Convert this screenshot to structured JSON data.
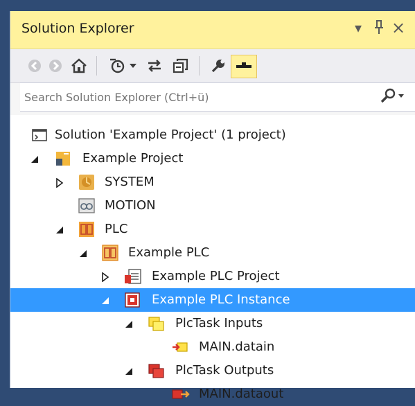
{
  "panel": {
    "title": "Solution Explorer",
    "pin_glyph": "▾",
    "dock_glyph": "⊥",
    "close_glyph": "×"
  },
  "toolbar": {
    "icons": [
      "back-icon",
      "forward-icon",
      "home-icon",
      "pending-changes-icon",
      "dropdown-icon",
      "sync-icon",
      "collapse-all-icon",
      "properties-icon",
      "preview-icon"
    ]
  },
  "search": {
    "placeholder": "Search Solution Explorer (Ctrl+ü)"
  },
  "tree": {
    "solution": "Solution 'Example Project' (1 project)",
    "project": "Example Project",
    "system": "SYSTEM",
    "motion": "MOTION",
    "plc": "PLC",
    "example_plc": "Example PLC",
    "plc_project": "Example PLC Project",
    "plc_instance": "Example PLC Instance",
    "task_inputs": "PlcTask Inputs",
    "main_datain": "MAIN.datain",
    "task_outputs": "PlcTask Outputs",
    "main_dataout": "MAIN.dataout"
  },
  "colors": {
    "title_bg": "#fff29d",
    "selection": "#3399ff",
    "frame": "#2f4b74"
  }
}
